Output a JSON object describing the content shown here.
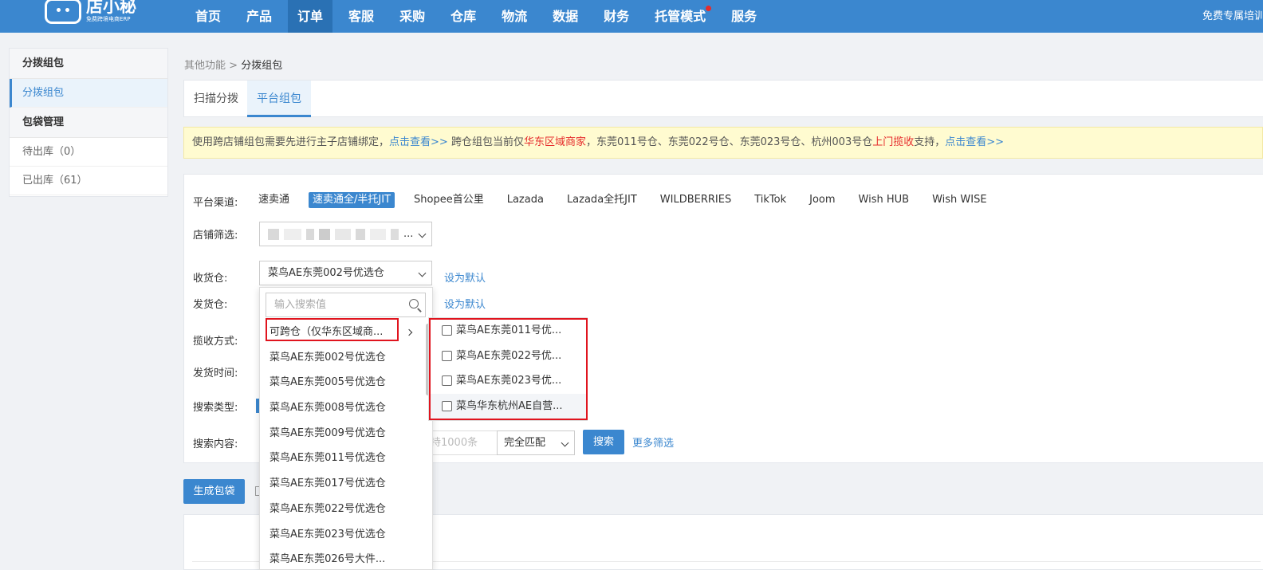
{
  "header": {
    "logo_text": "店小秘",
    "logo_subtitle": "免费跨境电商ERP",
    "nav": [
      "首页",
      "产品",
      "订单",
      "客服",
      "采购",
      "仓库",
      "物流",
      "数据",
      "财务",
      "托管模式",
      "服务"
    ],
    "active_nav": "订单",
    "right_text": "免费专属培训"
  },
  "sidebar": {
    "groups": [
      {
        "title": "分拨组包",
        "items": [
          "分拨组包"
        ]
      },
      {
        "title": "包袋管理",
        "items": [
          "待出库（0）",
          "已出库（61）"
        ]
      }
    ]
  },
  "breadcrumb": {
    "parent": "其他功能",
    "sep": ">",
    "current": "分拨组包"
  },
  "tabs": [
    "扫描分拨",
    "平台组包"
  ],
  "active_tab": "平台组包",
  "notice": {
    "p1": "使用跨店铺组包需要先进行主子店铺绑定，",
    "link1": "点击查看>>",
    "p2": " 跨仓组包当前仅",
    "red1": "华东区域商家",
    "p3": "，东莞011号仓、东莞022号仓、东莞023号仓、杭州003号仓",
    "red2": "上门揽收",
    "p4": "支持，",
    "link2": "点击查看>>"
  },
  "filters": {
    "channel_label": "平台渠道:",
    "channels": [
      "速卖通",
      "速卖通全/半托JIT",
      "Shopee首公里",
      "Lazada",
      "Lazada全托JIT",
      "WILDBERRIES",
      "TikTok",
      "Joom",
      "Wish HUB",
      "Wish WISE"
    ],
    "active_channel": "速卖通全/半托JIT",
    "shop_label": "店铺筛选:",
    "shop_value_suffix": "...",
    "receive_label": "收货仓:",
    "receive_value": "菜鸟AE东莞002号优选仓",
    "set_default": "设为默认",
    "ship_label": "发货仓:",
    "pickup_label": "揽收方式:",
    "time_label": "发货时间:",
    "search_type_label": "搜索类型:",
    "search_content_label": "搜索内容:",
    "keyword_placeholder_tail": "持1000条",
    "match_value": "完全匹配",
    "search_button": "搜索",
    "more_filters": "更多筛选"
  },
  "generate_button": "生成包袋",
  "dropdown": {
    "search_placeholder": "输入搜索值",
    "items": [
      "可跨仓（仅华东区域商...",
      "菜鸟AE东莞002号优选仓",
      "菜鸟AE东莞005号优选仓",
      "菜鸟AE东莞008号优选仓",
      "菜鸟AE东莞009号优选仓",
      "菜鸟AE东莞011号优选仓",
      "菜鸟AE东莞017号优选仓",
      "菜鸟AE东莞022号优选仓",
      "菜鸟AE东莞023号优选仓",
      "菜鸟AE东莞026号大件..."
    ]
  },
  "subpanel": {
    "items": [
      "菜鸟AE东莞011号优...",
      "菜鸟AE东莞022号优...",
      "菜鸟AE东莞023号优...",
      "菜鸟华东杭州AE自营..."
    ]
  },
  "colors": {
    "primary": "#3b87cf",
    "highlight_box": "#e0141e",
    "notice_bg": "#fffbd0"
  }
}
